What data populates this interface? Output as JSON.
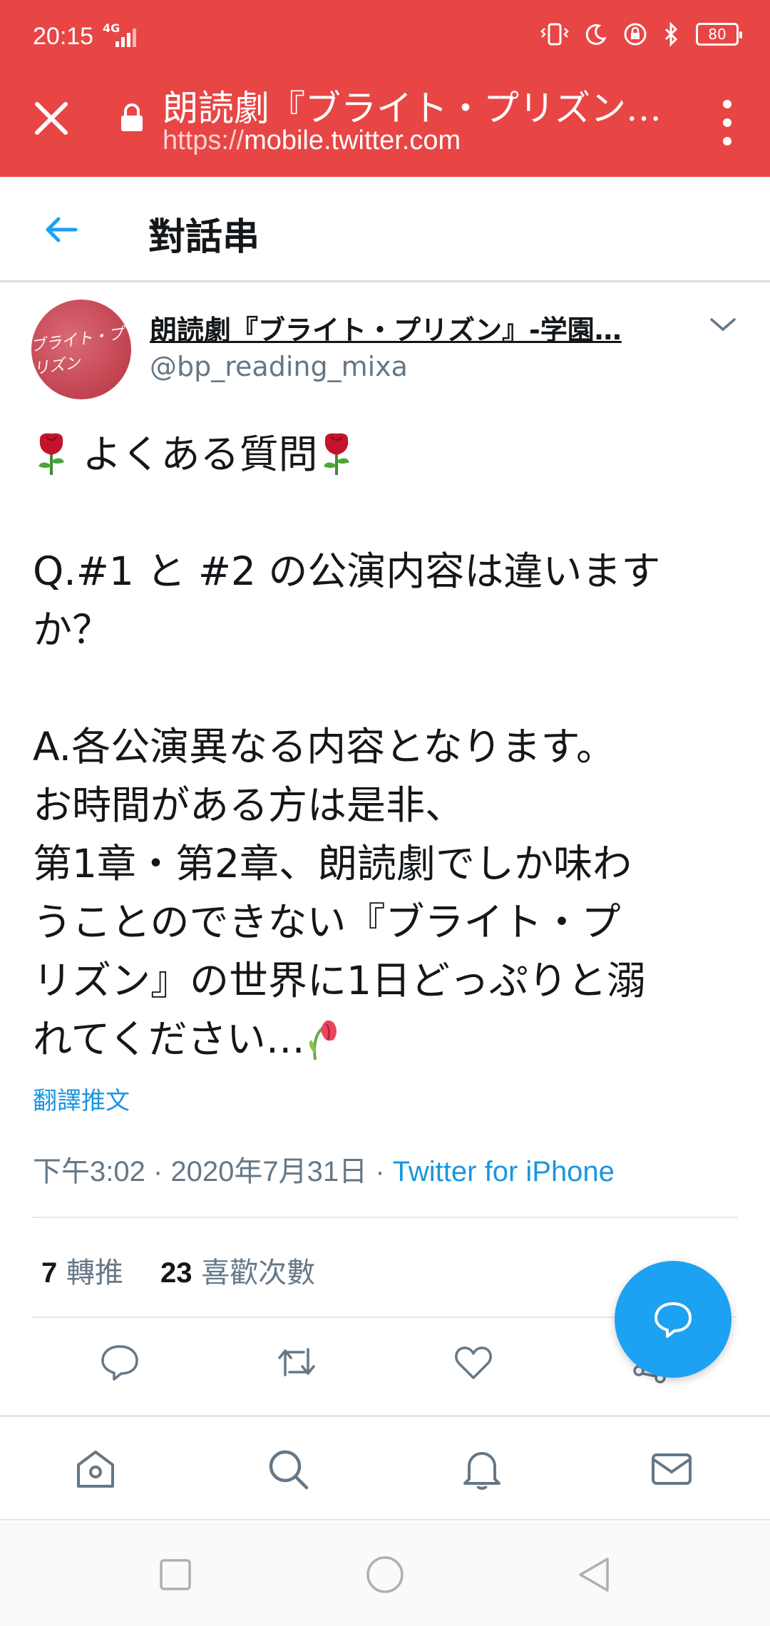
{
  "status_bar": {
    "time": "20:15",
    "network": "4G",
    "battery": "80"
  },
  "tab": {
    "title": "朗読劇『ブライト・プリズン』-学園…",
    "url_protocol": "https://",
    "url_host": "mobile.twitter.com"
  },
  "header": {
    "title": "對話串"
  },
  "tweet": {
    "avatar_text": "ブライト・プリズン",
    "author_name": "朗読劇『ブライト・プリズン』-学園…",
    "author_handle": "@bp_reading_mixa",
    "line_heading": "よくある質問",
    "body": "\nQ.#1 と #2 の公演内容は違います\nか？\n\nA.各公演異なる内容となります。\nお時間がある方は是非、\n第1章・第2章、朗読劇でしか味わ\nうことのできない『ブライト・プ\nリズン』の世界に1日どっぷりと溺\nれてください…",
    "translate": "翻譯推文",
    "time": "下午3:02 · 2020年7月31日 · ",
    "via": "Twitter for iPhone",
    "retweets_count": "7",
    "retweets_label": "轉推",
    "likes_count": "23",
    "likes_label": "喜歡次數"
  },
  "colors": {
    "header_red": "#e84545",
    "twitter_blue": "#1da1f2",
    "link_blue": "#1b95e0"
  }
}
